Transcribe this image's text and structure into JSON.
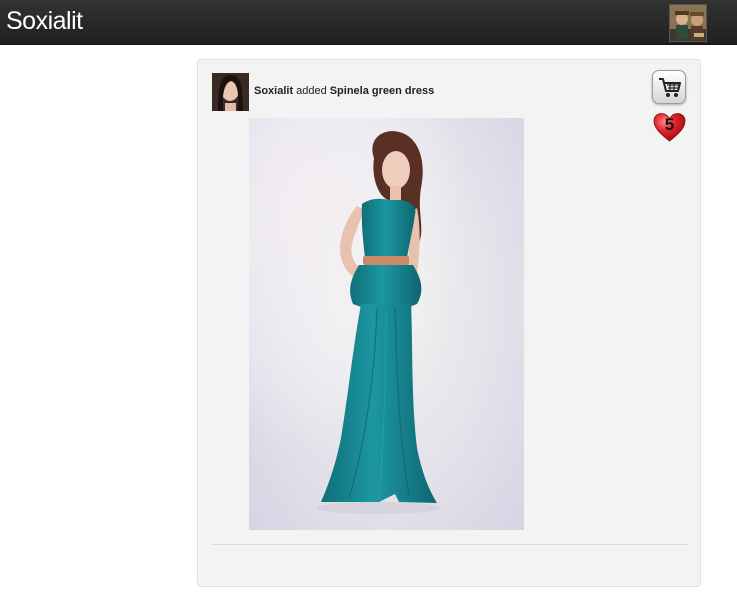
{
  "header": {
    "brand": "Soxialit"
  },
  "post": {
    "user": "Soxialit",
    "verb": "added",
    "item": "Spinela green dress",
    "likes": "5"
  },
  "icons": {
    "cart": "shopping-cart-icon",
    "heart": "heart-icon"
  },
  "colors": {
    "topbar": "#2a2a2a",
    "card_bg": "#f3f3f3",
    "dress": "#1a8e98",
    "heart": "#d0141c"
  }
}
